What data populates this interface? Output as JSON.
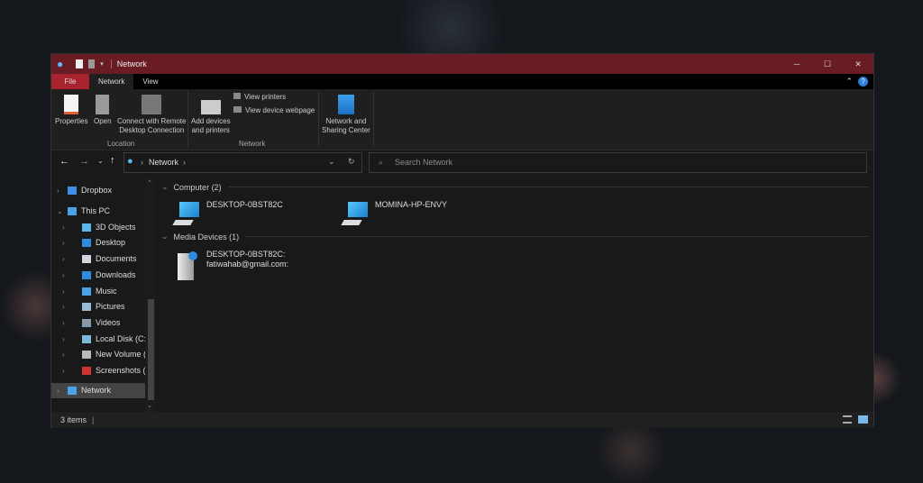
{
  "window": {
    "title": "Network",
    "controls": {
      "minimize": "─",
      "maximize": "☐",
      "close": "✕"
    }
  },
  "tabs": [
    {
      "label": "File"
    },
    {
      "label": "Network"
    },
    {
      "label": "View"
    }
  ],
  "ribbon": {
    "location": {
      "label": "Location",
      "buttons": [
        {
          "label": "Properties"
        },
        {
          "label": "Open"
        },
        {
          "label1": "Connect with Remote",
          "label2": "Desktop Connection"
        }
      ]
    },
    "network": {
      "label": "Network",
      "add": {
        "label1": "Add devices",
        "label2": "and printers"
      },
      "view_printers": "View printers",
      "view_webpage": "View device webpage"
    },
    "sharing": {
      "label1": "Network and",
      "label2": "Sharing Center"
    }
  },
  "address": {
    "path": "Network",
    "search_placeholder": "Search Network"
  },
  "nav": [
    {
      "label": "Dropbox",
      "level": 0,
      "expanded": false,
      "color": "#3d8fe8"
    },
    {
      "label": "This PC",
      "level": 0,
      "expanded": true,
      "color": "#4aa3e8"
    },
    {
      "label": "3D Objects",
      "level": 1,
      "color": "#5bb8e8"
    },
    {
      "label": "Desktop",
      "level": 1,
      "color": "#2e8de0"
    },
    {
      "label": "Documents",
      "level": 1,
      "color": "#cfd6e0"
    },
    {
      "label": "Downloads",
      "level": 1,
      "color": "#2e8de0"
    },
    {
      "label": "Music",
      "level": 1,
      "color": "#4aa3e8"
    },
    {
      "label": "Pictures",
      "level": 1,
      "color": "#9ab8d8"
    },
    {
      "label": "Videos",
      "level": 1,
      "color": "#8899aa"
    },
    {
      "label": "Local Disk (C:)",
      "level": 1,
      "color": "#7ab8d8"
    },
    {
      "label": "New Volume (D:)",
      "level": 1,
      "color": "#bbbbbb"
    },
    {
      "label": "Screenshots (\\\\M",
      "level": 1,
      "color": "#cc3333"
    },
    {
      "label": "Network",
      "level": 0,
      "selected": true,
      "color": "#4aa3e8"
    }
  ],
  "groups": [
    {
      "label": "Computer (2)",
      "items": [
        {
          "name": "DESKTOP-0BST82C"
        },
        {
          "name": "MOMINA-HP-ENVY"
        }
      ]
    },
    {
      "label": "Media Devices (1)",
      "items": [
        {
          "name": "DESKTOP-0BST82C:",
          "sub": "fatiwahab@gmail.com:"
        }
      ]
    }
  ],
  "status": {
    "count": "3 items"
  },
  "colors": {
    "titlebar": "#6a1c24",
    "file_tab": "#a8232e",
    "accent": "#2e8de0"
  }
}
